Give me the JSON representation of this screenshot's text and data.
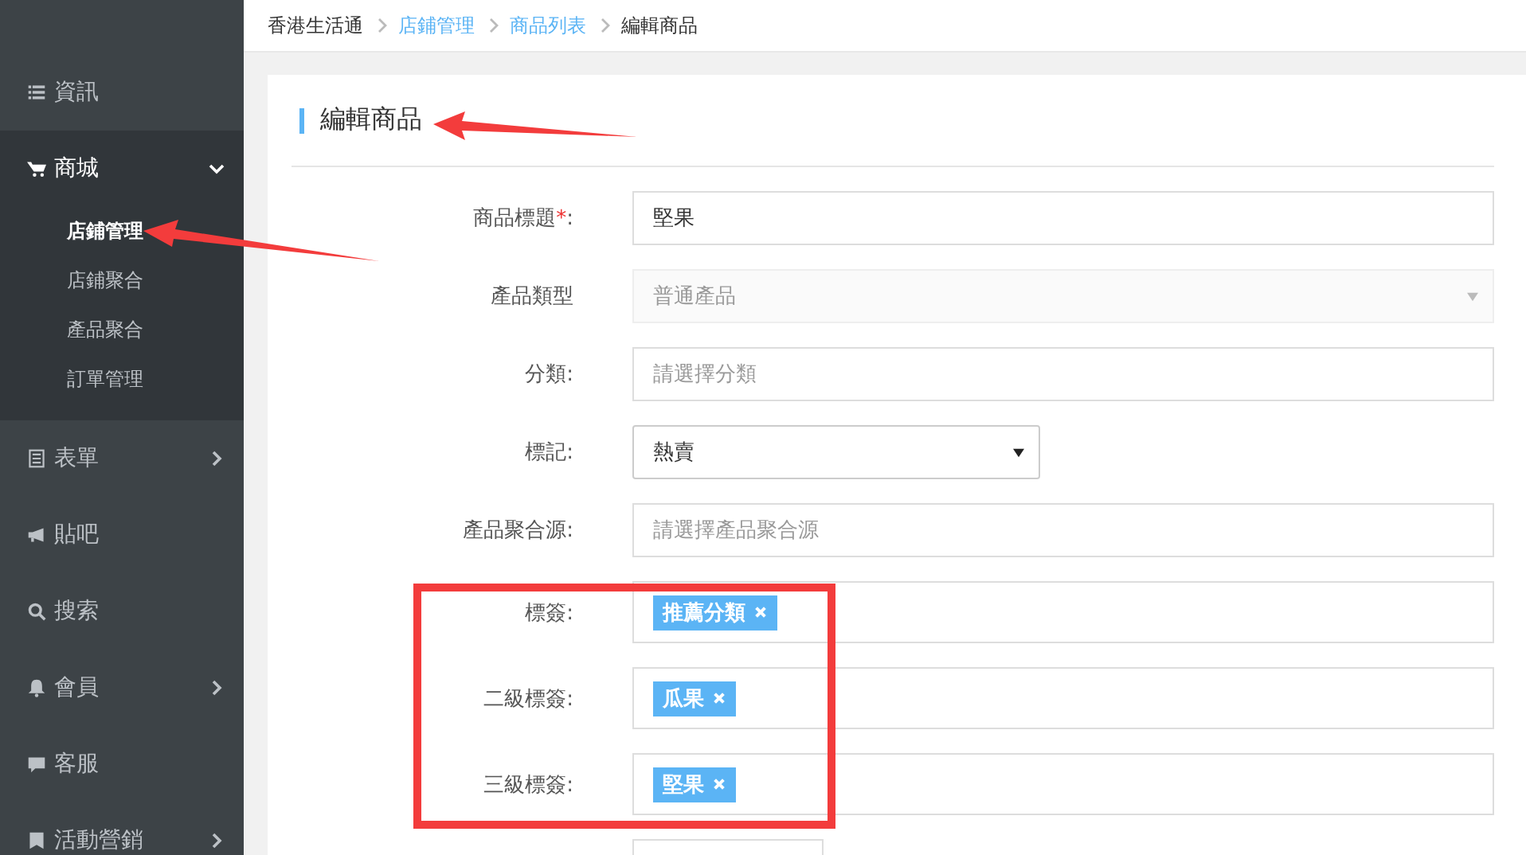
{
  "sidebar": {
    "items": [
      {
        "label": "資訊",
        "selected": false,
        "expanded": false,
        "has_children": false
      },
      {
        "label": "商城",
        "selected": true,
        "expanded": true,
        "has_children": true,
        "children": [
          {
            "label": "店鋪管理",
            "selected": true
          },
          {
            "label": "店鋪聚合",
            "selected": false
          },
          {
            "label": "產品聚合",
            "selected": false
          },
          {
            "label": "訂單管理",
            "selected": false
          }
        ]
      },
      {
        "label": "表單",
        "selected": false,
        "expanded": false,
        "has_children": true
      },
      {
        "label": "貼吧",
        "selected": false,
        "expanded": false,
        "has_children": false
      },
      {
        "label": "搜索",
        "selected": false,
        "expanded": false,
        "has_children": false
      },
      {
        "label": "會員",
        "selected": false,
        "expanded": false,
        "has_children": true
      },
      {
        "label": "客服",
        "selected": false,
        "expanded": false,
        "has_children": false
      },
      {
        "label": "活動營銷",
        "selected": false,
        "expanded": false,
        "has_children": true
      }
    ]
  },
  "breadcrumb": [
    {
      "label": "香港生活通",
      "kind": "text"
    },
    {
      "label": "店鋪管理",
      "kind": "link"
    },
    {
      "label": "商品列表",
      "kind": "link"
    },
    {
      "label": "編輯商品",
      "kind": "text"
    }
  ],
  "page_title": "編輯商品",
  "form": {
    "fields": [
      {
        "kind": "text",
        "label": "商品標題",
        "required_mark": "*",
        "label_end": ":",
        "value": "堅果"
      },
      {
        "kind": "select",
        "label": "產品類型",
        "value": "普通產品",
        "disabled": true,
        "wide": true
      },
      {
        "kind": "text",
        "label": "分類:",
        "placeholder": "請選擇分類"
      },
      {
        "kind": "select",
        "label": "標記:",
        "value": "熱賣",
        "disabled": false,
        "wide": false
      },
      {
        "kind": "text",
        "label": "產品聚合源:",
        "placeholder": "請選擇產品聚合源"
      },
      {
        "kind": "tags",
        "label": "標簽:",
        "tags": [
          "推薦分類"
        ]
      },
      {
        "kind": "tags",
        "label": "二級標簽:",
        "tags": [
          "瓜果"
        ]
      },
      {
        "kind": "tags",
        "label": "三級標簽:",
        "tags": [
          "堅果"
        ]
      },
      {
        "kind": "partial"
      }
    ]
  }
}
